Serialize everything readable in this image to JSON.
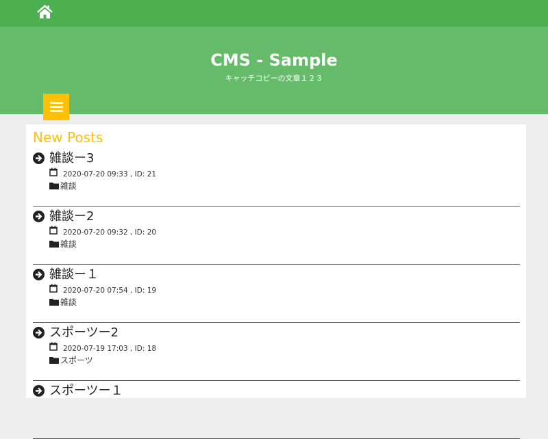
{
  "nav": {
    "home_icon": "home-icon",
    "menu_icon": "menu-icon"
  },
  "header": {
    "title": "CMS - Sample",
    "tagline": "キャッチコピーの文章１２３"
  },
  "colors": {
    "topbar": "#4caf50",
    "header": "#66bb6a",
    "accent": "#ffc107"
  },
  "main": {
    "heading": "New Posts",
    "posts": [
      {
        "title": "雑談ー3",
        "date": "2020-07-20 09:33 , ID: 21",
        "category": "雑談"
      },
      {
        "title": "雑談ー2",
        "date": "2020-07-20 09:32 , ID: 20",
        "category": "雑談"
      },
      {
        "title": "雑談ー１",
        "date": "2020-07-20 07:54 , ID: 19",
        "category": "雑談"
      },
      {
        "title": "スポーツー2",
        "date": "2020-07-19 17:03 , ID: 18",
        "category": "スポーツ"
      },
      {
        "title": "スポーツー１",
        "date": "",
        "category": ""
      }
    ]
  }
}
